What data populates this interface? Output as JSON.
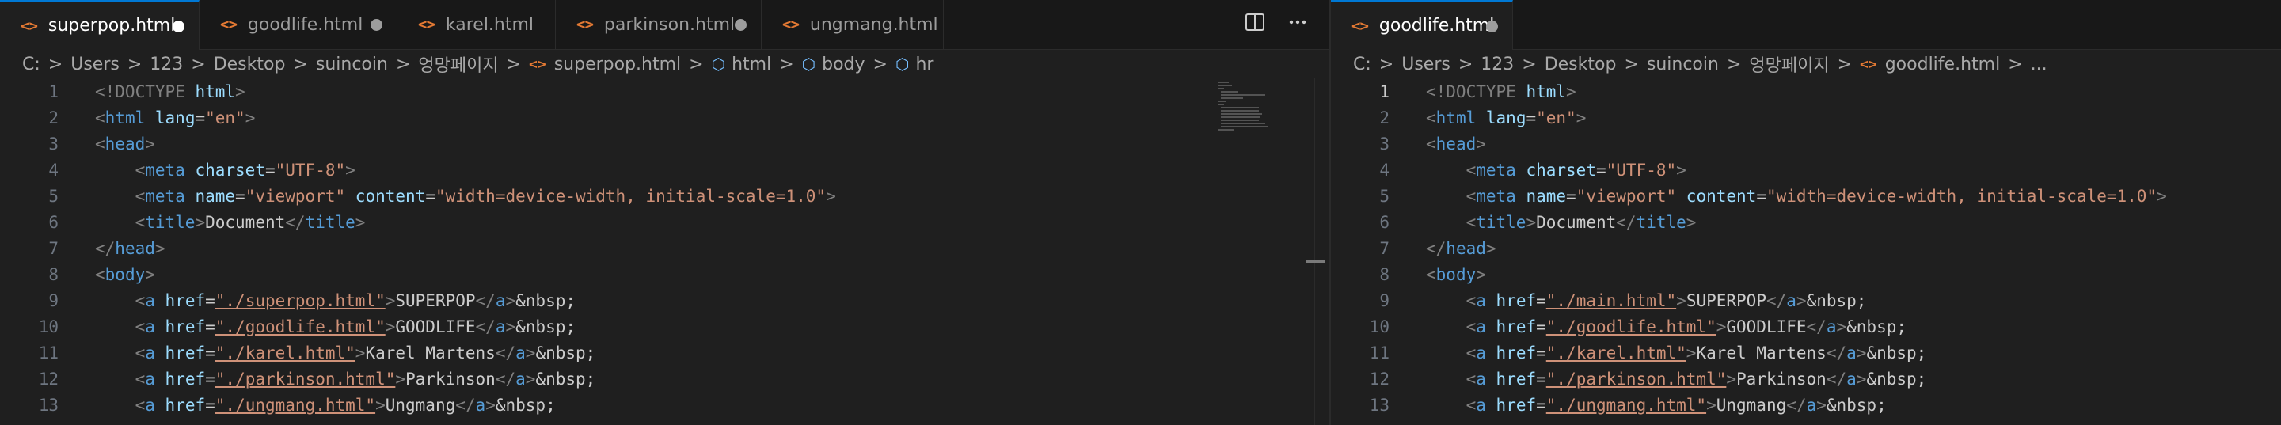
{
  "left": {
    "tabs": [
      {
        "label": "superpop.html",
        "active": true,
        "dirty": true
      },
      {
        "label": "goodlife.html",
        "active": false,
        "dirty": true
      },
      {
        "label": "karel.html",
        "active": false,
        "dirty": false
      },
      {
        "label": "parkinson.html",
        "active": false,
        "dirty": true
      },
      {
        "label": "ungmang.html",
        "active": false,
        "dirty": false
      }
    ],
    "actions": {
      "split": "split-editor-icon",
      "more": "more-actions-icon"
    },
    "breadcrumb": [
      "C:",
      "Users",
      "123",
      "Desktop",
      "suincoin",
      "엉망페이지",
      "superpop.html",
      "html",
      "body",
      "hr"
    ],
    "lines": [
      "1",
      "2",
      "3",
      "4",
      "5",
      "6",
      "7",
      "8",
      "9",
      "10",
      "11",
      "12",
      "13"
    ],
    "code": {
      "doctype": "<!DOCTYPE",
      "html_kw": "html",
      "lang_val": "\"en\"",
      "charset_val": "\"UTF-8\"",
      "viewport_val": "\"viewport\"",
      "content_val": "\"width=device-width, initial-scale=1.0\"",
      "title_text": "Document",
      "hrefs": [
        "\"./superpop.html\"",
        "\"./goodlife.html\"",
        "\"./karel.html\"",
        "\"./parkinson.html\"",
        "\"./ungmang.html\""
      ],
      "link_texts": [
        "SUPERPOP",
        "GOODLIFE",
        "Karel Martens",
        "Parkinson",
        "Ungmang"
      ],
      "nbsp": "&nbsp;"
    }
  },
  "right": {
    "tabs": [
      {
        "label": "goodlife.html",
        "active": true,
        "dirty": true
      }
    ],
    "breadcrumb": [
      "C:",
      "Users",
      "123",
      "Desktop",
      "suincoin",
      "엉망페이지",
      "goodlife.html",
      "..."
    ],
    "lines": [
      "1",
      "2",
      "3",
      "4",
      "5",
      "6",
      "7",
      "8",
      "9",
      "10",
      "11",
      "12",
      "13"
    ],
    "code": {
      "hrefs": [
        "\"./main.html\"",
        "\"./goodlife.html\"",
        "\"./karel.html\"",
        "\"./parkinson.html\"",
        "\"./ungmang.html\""
      ],
      "link_texts": [
        "SUPERPOP",
        "GOODLIFE",
        "Karel Martens",
        "Parkinson",
        "Ungmang"
      ]
    }
  }
}
